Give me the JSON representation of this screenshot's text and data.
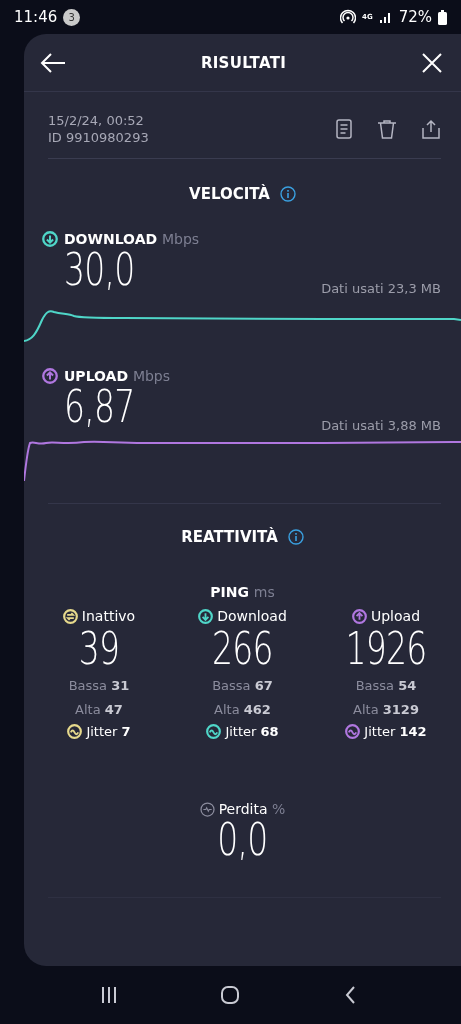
{
  "status_bar": {
    "time": "11:46",
    "notification_count": "3",
    "network_type": "4G",
    "battery": "72%"
  },
  "header": {
    "title": "RISULTATI"
  },
  "result": {
    "date": "15/2/24, 00:52",
    "id": "ID 9910980293"
  },
  "speed": {
    "title": "VELOCITÀ",
    "tests": [
      {
        "kind": "download",
        "label": "DOWNLOAD",
        "unit": "Mbps",
        "value": "30,0",
        "data_used": "Dati usati 23,3 MB",
        "color": "#4fd6c8"
      },
      {
        "kind": "upload",
        "label": "UPLOAD",
        "unit": "Mbps",
        "value": "6,87",
        "data_used": "Dati usati 3,88 MB",
        "color": "#b077e0"
      }
    ]
  },
  "responsiveness": {
    "title": "REATTIVITÀ",
    "ping_label": "PING",
    "ping_unit": "ms",
    "columns": [
      {
        "kind": "idle",
        "label": "Inattivo",
        "value": "39",
        "low_label": "Bassa",
        "low": "31",
        "high_label": "Alta",
        "high": "47",
        "jitter_label": "Jitter",
        "jitter": "7",
        "color": "#e6d98c"
      },
      {
        "kind": "download",
        "label": "Download",
        "value": "266",
        "low_label": "Bassa",
        "low": "67",
        "high_label": "Alta",
        "high": "462",
        "jitter_label": "Jitter",
        "jitter": "68",
        "color": "#4fd6c8"
      },
      {
        "kind": "upload",
        "label": "Upload",
        "value": "1926",
        "low_label": "Bassa",
        "low": "54",
        "high_label": "Alta",
        "high": "3129",
        "jitter_label": "Jitter",
        "jitter": "142",
        "color": "#b077e0"
      }
    ]
  },
  "loss": {
    "label": "Perdita",
    "unit": "%",
    "value": "0,0"
  }
}
